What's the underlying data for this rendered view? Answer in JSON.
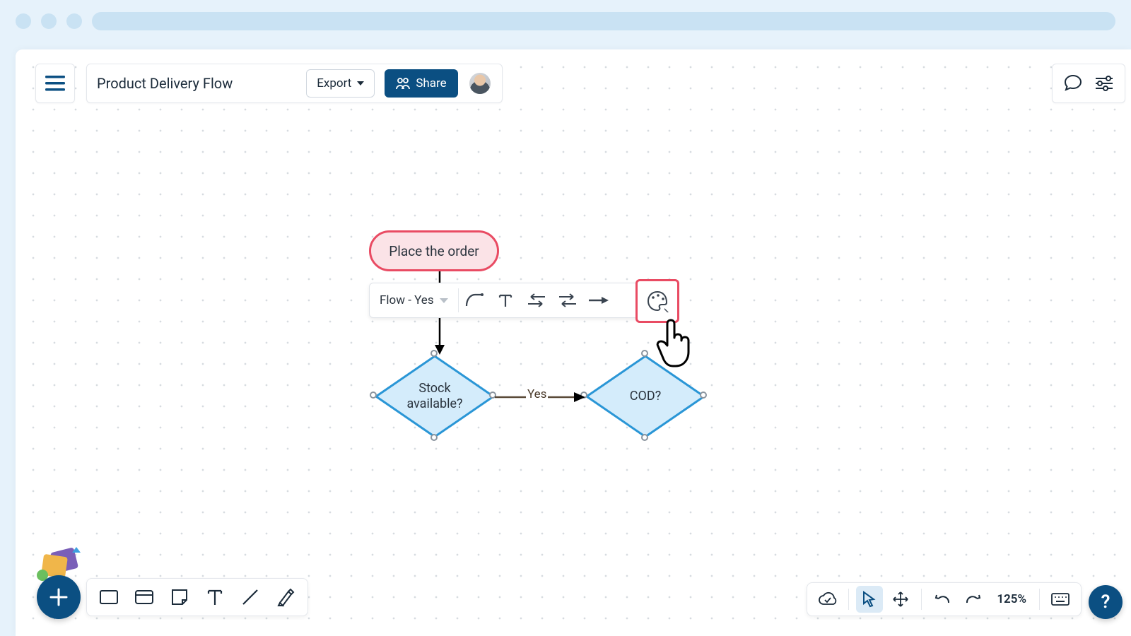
{
  "header": {
    "doc_title": "Product Delivery Flow",
    "export_label": "Export",
    "share_label": "Share"
  },
  "context_toolbar": {
    "select_label": "Flow - Yes"
  },
  "nodes": {
    "start": "Place the order",
    "stock": "Stock\navailable?",
    "cod": "COD?"
  },
  "flows": {
    "yes_label": "Yes"
  },
  "status": {
    "zoom": "125%"
  },
  "help": {
    "label": "?"
  }
}
